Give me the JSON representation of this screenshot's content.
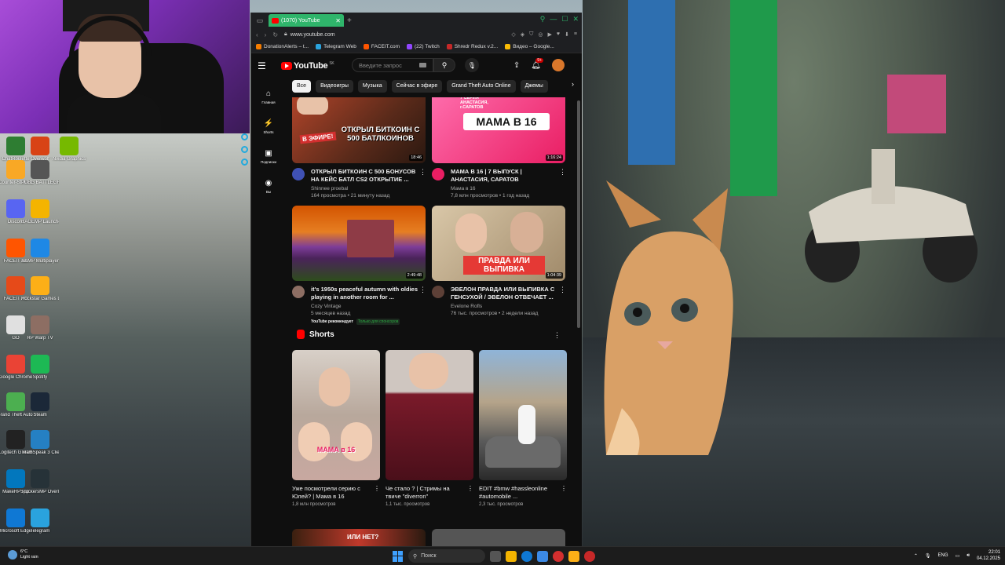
{
  "browser": {
    "tab_title": "(1070) YouTube",
    "url": "www.youtube.com",
    "bookmarks": [
      {
        "label": "DonationAlerts – t...",
        "color": "#f57c00"
      },
      {
        "label": "Telegram Web",
        "color": "#2aa3de"
      },
      {
        "label": "FACEIT.com",
        "color": "#ff5500"
      },
      {
        "label": "(22) Twitch",
        "color": "#9146ff"
      },
      {
        "label": "Shredr Redux v.2...",
        "color": "#c62828"
      },
      {
        "label": "Видео – Google...",
        "color": "#fbbc04"
      }
    ]
  },
  "youtube": {
    "logo": "YouTube",
    "logo_country": "SK",
    "search_placeholder": "Введите запрос",
    "notif_count": "9+",
    "chips": [
      "Все",
      "Видеоигры",
      "Музыка",
      "Сейчас в эфире",
      "Grand Theft Auto Online",
      "Джемы"
    ],
    "nav": [
      {
        "label": "Главная",
        "icon": "home-icon",
        "glyph": "⌂"
      },
      {
        "label": "Shorts",
        "icon": "shorts-icon",
        "glyph": "⚡"
      },
      {
        "label": "Подписки",
        "icon": "subscriptions-icon",
        "glyph": "▣"
      },
      {
        "label": "Вы",
        "icon": "you-icon",
        "glyph": "◉"
      }
    ],
    "videos": [
      {
        "title": "ОТКРЫЛ БИТКОИН С 500 БОНУСОВ НА КЕЙС БАТЛ CS2 ОТКРЫТИЕ ...",
        "channel": "Shinnee proebal",
        "stats": "164 просмотра • 21 минуту назад",
        "duration": "18:46",
        "thumb_text": "ОТКРЫЛ БИТКОИН С 500 БАТЛКОИНОВ",
        "thumb_badge": "В ЭФИРЕ!"
      },
      {
        "title": "МАМА В 16 | 7 ВЫПУСК | АНАСТАСИЯ, САРАТОВ",
        "channel": "Мама в 16",
        "stats": "7,8 млн просмотров • 1 год назад",
        "duration": "1:16:24",
        "thumb_text": "МАМА В 16",
        "thumb_sub": "7 СЕРИЯ АНАСТАСИЯ, г.САРАТОВ"
      },
      {
        "title": "it's 1950s peaceful autumn with oldies playing in another room for ...",
        "channel": "Cozy Vintage",
        "stats": "5 месяцев назад",
        "duration": "2:49:48",
        "badge1": "YouTube рекомендует",
        "badge2": "Только для спонсоров"
      },
      {
        "title": "ЭВЕЛОН ПРАВДА ИЛИ ВЫПИВКА С ГЕНСУХОЙ / ЭВЕЛОН ОТВЕЧАЕТ ...",
        "channel": "Evelone Rofls",
        "stats": "76 тыс. просмотров • 2 недели назад",
        "duration": "1:04:39",
        "thumb_text": "ПРАВДА ИЛИ ВЫПИВКА"
      }
    ],
    "shorts_title": "Shorts",
    "shorts": [
      {
        "title": "Уже посмотрели серию с Юлей? | Мама в 16",
        "views": "1,8 млн просмотров",
        "thumb_text": "МАМА в 16"
      },
      {
        "title": "Че стало ? | Стримы на твиче \"diverron\"",
        "views": "1,1 тыс. просмотров"
      },
      {
        "title": "EDIT #bmw #hassleonline #automobile ...",
        "views": "2,3 тыс. просмотров"
      }
    ],
    "peek_text": "ИЛИ НЕТ?"
  },
  "desktop_icons": [
    {
      "label": "ChatRoulette",
      "color": "#2e7d32"
    },
    {
      "label": "Overwolf",
      "color": "#d84315"
    },
    {
      "label": "Nvidia Graphics",
      "color": "#76b900"
    },
    {
      "label": "Counter-Strike 2",
      "color": "#f9a825"
    },
    {
      "label": "PUBG BATTLEGROUNDS",
      "color": "#555555"
    },
    {
      "label": "Discord",
      "color": "#5865f2"
    },
    {
      "label": "RAGEMP Launcher",
      "color": "#f4b400"
    },
    {
      "label": "FACEIT AC",
      "color": "#ff5500"
    },
    {
      "label": "SAMP Multiplayer",
      "color": "#1e88e5"
    },
    {
      "label": "FACEIT AC",
      "color": "#e64a19"
    },
    {
      "label": "Rockstar Games L...",
      "color": "#fcaf17"
    },
    {
      "label": "GO",
      "color": "#e0e0e0"
    },
    {
      "label": "RP Warp TV",
      "color": "#8d6e63"
    },
    {
      "label": "Google Chrome",
      "color": "#ea4335"
    },
    {
      "label": "Spotify",
      "color": "#1db954"
    },
    {
      "label": "Grand Theft Auto V Le...",
      "color": "#4caf50"
    },
    {
      "label": "Steam",
      "color": "#1b2838"
    },
    {
      "label": "Logitech G HUB",
      "color": "#222222"
    },
    {
      "label": "TeamSpeak 3 Client",
      "color": "#2580c3"
    },
    {
      "label": "MakeRPSpp",
      "color": "#0277bd"
    },
    {
      "label": "TruckersMP Overlay",
      "color": "#263238"
    },
    {
      "label": "Microsoft Edge",
      "color": "#0f78d4"
    },
    {
      "label": "Telegram",
      "color": "#2aa3de"
    }
  ],
  "taskbar": {
    "weather_temp": "6°C",
    "weather_desc": "Light rain",
    "search_label": "Поиск",
    "lang": "ENG",
    "time": "22:01",
    "date": "04.12.2025"
  }
}
